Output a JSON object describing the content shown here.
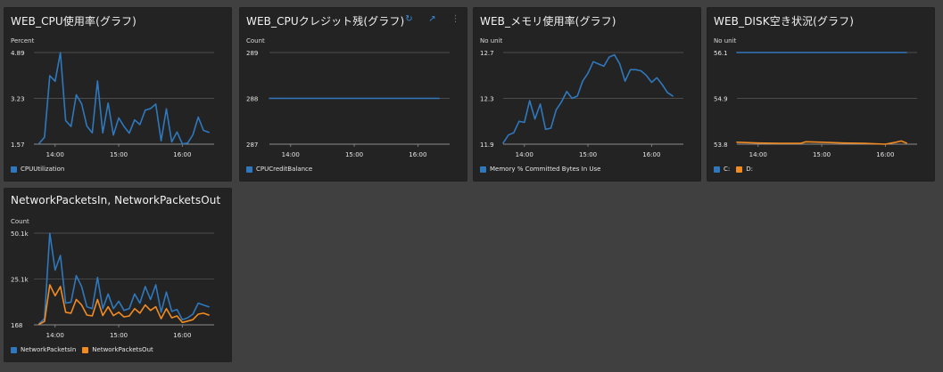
{
  "colors": {
    "blue": "#2f78bd",
    "orange": "#f28b22",
    "grid": "#5b5b5b",
    "axis": "#8c8c8c",
    "text": "#e6e6e6",
    "panel": "#232323",
    "background": "#404040",
    "control": "#3b8de0"
  },
  "panels": [
    {
      "title": "WEB_CPU使用率(グラフ)",
      "unit": "Percent",
      "legend": [
        {
          "label": "CPUUtilization",
          "color": "#2f78bd"
        }
      ]
    },
    {
      "title": "WEB_CPUクレジット残(グラフ)",
      "unit": "Count",
      "legend": [
        {
          "label": "CPUCreditBalance",
          "color": "#2f78bd"
        }
      ],
      "controls": [
        "refresh-icon",
        "expand-icon",
        "more-icon"
      ]
    },
    {
      "title": "WEB_メモリ使用率(グラフ)",
      "unit": "No unit",
      "legend": [
        {
          "label": "Memory % Committed Bytes In Use",
          "color": "#2f78bd"
        }
      ]
    },
    {
      "title": "WEB_DISK空き状況(グラフ)",
      "unit": "No unit",
      "legend": [
        {
          "label": "C:",
          "color": "#2f78bd"
        },
        {
          "label": "D:",
          "color": "#f28b22"
        }
      ]
    },
    {
      "title": "NetworkPacketsIn, NetworkPacketsOut",
      "unit": "Count",
      "legend": [
        {
          "label": "NetworkPacketsIn",
          "color": "#2f78bd"
        },
        {
          "label": "NetworkPacketsOut",
          "color": "#f28b22"
        }
      ]
    }
  ],
  "chart_data": [
    {
      "type": "line",
      "title": "WEB_CPU使用率(グラフ)",
      "ylabel": "Percent",
      "x_ticks": [
        "14:00",
        "15:00",
        "16:00"
      ],
      "y_ticks": [
        "1.57",
        "3.23",
        "4.89"
      ],
      "ylim": [
        1.57,
        4.89
      ],
      "grid": true,
      "legend_position": "bottom-left",
      "x": [
        "13:45",
        "13:50",
        "13:55",
        "14:00",
        "14:05",
        "14:10",
        "14:15",
        "14:20",
        "14:25",
        "14:30",
        "14:35",
        "14:40",
        "14:45",
        "14:50",
        "14:55",
        "15:00",
        "15:05",
        "15:10",
        "15:15",
        "15:20",
        "15:25",
        "15:30",
        "15:35",
        "15:40",
        "15:45",
        "15:50",
        "15:55",
        "16:00",
        "16:05",
        "16:10",
        "16:15",
        "16:20",
        "16:25"
      ],
      "series": [
        {
          "name": "CPUUtilization",
          "color": "#2f78bd",
          "values": [
            1.6,
            1.82,
            4.05,
            3.85,
            4.89,
            2.42,
            2.21,
            3.36,
            3.03,
            2.22,
            1.98,
            3.86,
            1.98,
            3.06,
            1.9,
            2.52,
            2.21,
            1.97,
            2.45,
            2.28,
            2.8,
            2.86,
            3.02,
            1.69,
            2.85,
            1.65,
            2.01,
            1.58,
            1.61,
            1.91,
            2.55,
            2.07,
            2.0
          ]
        }
      ]
    },
    {
      "type": "line",
      "title": "WEB_CPUクレジット残(グラフ)",
      "ylabel": "Count",
      "x_ticks": [
        "14:00",
        "15:00",
        "16:00"
      ],
      "y_ticks": [
        "287",
        "288",
        "289"
      ],
      "ylim": [
        287,
        289
      ],
      "grid": true,
      "legend_position": "bottom-left",
      "x": [
        "13:40",
        "16:20"
      ],
      "series": [
        {
          "name": "CPUCreditBalance",
          "color": "#2f78bd",
          "values": [
            288,
            288
          ]
        }
      ]
    },
    {
      "type": "line",
      "title": "WEB_メモリ使用率(グラフ)",
      "ylabel": "No unit",
      "x_ticks": [
        "14:00",
        "15:00",
        "16:00"
      ],
      "y_ticks": [
        "11.9",
        "12.3",
        "12.7"
      ],
      "ylim": [
        11.9,
        12.7
      ],
      "grid": true,
      "legend_position": "bottom-left",
      "x": [
        "13:40",
        "13:45",
        "13:50",
        "13:55",
        "14:00",
        "14:05",
        "14:10",
        "14:15",
        "14:20",
        "14:25",
        "14:30",
        "14:35",
        "14:40",
        "14:45",
        "14:50",
        "14:55",
        "15:00",
        "15:05",
        "15:10",
        "15:15",
        "15:20",
        "15:25",
        "15:30",
        "15:35",
        "15:40",
        "15:45",
        "15:50",
        "15:55",
        "16:00",
        "16:05",
        "16:10",
        "16:15",
        "16:20"
      ],
      "series": [
        {
          "name": "Memory % Committed Bytes In Use",
          "color": "#2f78bd",
          "values": [
            11.91,
            11.98,
            12.0,
            12.1,
            12.09,
            12.28,
            12.12,
            12.25,
            12.03,
            12.04,
            12.2,
            12.27,
            12.36,
            12.3,
            12.32,
            12.45,
            12.52,
            12.62,
            12.6,
            12.58,
            12.66,
            12.68,
            12.6,
            12.45,
            12.55,
            12.55,
            12.54,
            12.5,
            12.44,
            12.48,
            12.42,
            12.35,
            12.32
          ]
        }
      ]
    },
    {
      "type": "line",
      "title": "WEB_DISK空き状況(グラフ)",
      "ylabel": "No unit",
      "x_ticks": [
        "14:00",
        "15:00",
        "16:00"
      ],
      "y_ticks": [
        "53.8",
        "54.9",
        "56.1"
      ],
      "ylim": [
        53.8,
        56.1
      ],
      "grid": true,
      "legend_position": "bottom-left",
      "x": [
        "13:40",
        "14:00",
        "14:20",
        "14:40",
        "14:45",
        "15:00",
        "15:20",
        "15:40",
        "16:00",
        "16:10",
        "16:15",
        "16:20"
      ],
      "series": [
        {
          "name": "C:",
          "color": "#2f78bd",
          "values": [
            56.1,
            56.1,
            56.1,
            56.1,
            56.1,
            56.1,
            56.1,
            56.1,
            56.1,
            56.1,
            56.1,
            56.1
          ]
        },
        {
          "name": "D:",
          "color": "#f28b22",
          "values": [
            53.85,
            53.83,
            53.82,
            53.82,
            53.86,
            53.85,
            53.83,
            53.82,
            53.8,
            53.85,
            53.88,
            53.83
          ]
        }
      ]
    },
    {
      "type": "line",
      "title": "NetworkPacketsIn, NetworkPacketsOut",
      "ylabel": "Count",
      "x_ticks": [
        "14:00",
        "15:00",
        "16:00"
      ],
      "y_ticks": [
        "168",
        "25.1k",
        "50.1k"
      ],
      "ylim": [
        168,
        50100
      ],
      "grid": true,
      "legend_position": "bottom-left",
      "x": [
        "13:45",
        "13:50",
        "13:55",
        "14:00",
        "14:05",
        "14:10",
        "14:15",
        "14:20",
        "14:25",
        "14:30",
        "14:35",
        "14:40",
        "14:45",
        "14:50",
        "14:55",
        "15:00",
        "15:05",
        "15:10",
        "15:15",
        "15:20",
        "15:25",
        "15:30",
        "15:35",
        "15:40",
        "15:45",
        "15:50",
        "15:55",
        "16:00",
        "16:05",
        "16:10",
        "16:15",
        "16:20",
        "16:25"
      ],
      "series": [
        {
          "name": "NetworkPacketsIn",
          "color": "#2f78bd",
          "values": [
            800,
            3500,
            50100,
            30000,
            38000,
            12000,
            12500,
            27000,
            21000,
            10000,
            9000,
            26000,
            9000,
            17000,
            9000,
            13000,
            8000,
            9000,
            17000,
            12000,
            21000,
            14000,
            22000,
            7000,
            18000,
            7500,
            8500,
            3000,
            4000,
            6000,
            12000,
            11000,
            10000
          ]
        },
        {
          "name": "NetworkPacketsOut",
          "color": "#f28b22",
          "values": [
            500,
            2000,
            22000,
            16000,
            21000,
            7000,
            6500,
            14000,
            11000,
            5500,
            5000,
            14000,
            5200,
            10000,
            5200,
            7000,
            4500,
            5000,
            9000,
            6500,
            11000,
            8000,
            10000,
            3500,
            9000,
            4000,
            5000,
            1500,
            2200,
            3000,
            6000,
            6500,
            5500
          ]
        }
      ]
    }
  ]
}
